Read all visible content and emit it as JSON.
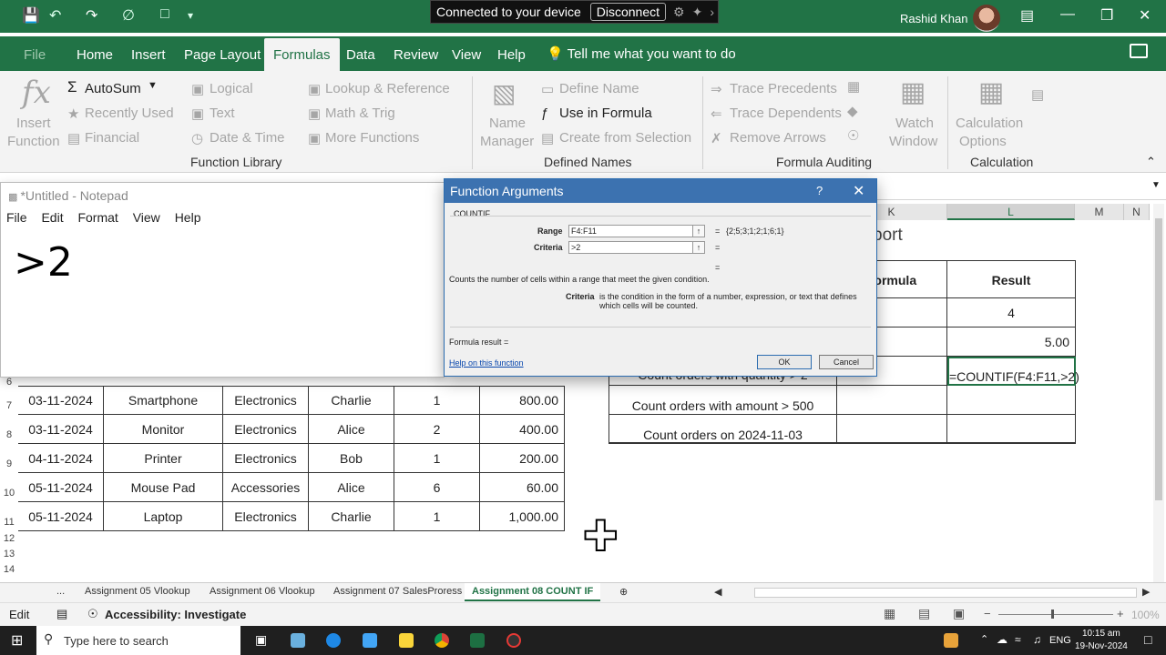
{
  "titlebar": {
    "remote_connected": "Connected to your device",
    "remote_disconnect": "Disconnect",
    "user_name": "Rashid Khan"
  },
  "tabs": [
    "File",
    "Home",
    "Insert",
    "Page Layout",
    "Formulas",
    "Data",
    "Review",
    "View",
    "Help"
  ],
  "active_tab": "Formulas",
  "tell_me": "Tell me what you want to do",
  "ribbon": {
    "insert_function": [
      "Insert",
      "Function"
    ],
    "autosum": "AutoSum",
    "recently_used": "Recently Used",
    "financial": "Financial",
    "logical": "Logical",
    "text": "Text",
    "date_time": "Date & Time",
    "lookup": "Lookup & Reference",
    "math": "Math & Trig",
    "more": "More Functions",
    "group_function_library": "Function Library",
    "name_manager": [
      "Name",
      "Manager"
    ],
    "define_name": "Define Name",
    "use_in_formula": "Use in Formula",
    "create_from_selection": "Create from Selection",
    "group_defined_names": "Defined Names",
    "trace_precedents": "Trace Precedents",
    "trace_dependents": "Trace Dependents",
    "remove_arrows": "Remove Arrows",
    "watch_window": [
      "Watch",
      "Window"
    ],
    "group_formula_auditing": "Formula Auditing",
    "calc_options": [
      "Calculation",
      "Options"
    ],
    "group_calculation": "Calculation"
  },
  "notepad": {
    "title": "*Untitled - Notepad",
    "menu": [
      "File",
      "Edit",
      "Format",
      "View",
      "Help"
    ],
    "content": ">2"
  },
  "dialog": {
    "title": "Function Arguments",
    "help_q": "?",
    "function_name": "COUNTIF",
    "range_label": "Range",
    "range_value": "F4:F11",
    "range_result": "{2;5;3;1;2;1;6;1}",
    "criteria_label": "Criteria",
    "criteria_value": ">2",
    "equals": "=",
    "description": "Counts the number of cells within a range that meet the given condition.",
    "arg_name": "Criteria",
    "arg_desc_1": "is the condition in the form of a number, expression, or text that defines",
    "arg_desc_2": "which cells will be counted.",
    "formula_result": "Formula result =",
    "help_link": "Help on this function",
    "ok": "OK",
    "cancel": "Cancel"
  },
  "sheet": {
    "col_headers": [
      "K",
      "L",
      "M",
      "N"
    ],
    "report_title_fragment": "port",
    "report_headers": [
      "Formula",
      "Result"
    ],
    "report_rows": [
      {
        "label": "",
        "formula": "",
        "result": "4"
      },
      {
        "label": "",
        "formula": "",
        "result": "5.00"
      },
      {
        "label": "Count orders with quantity > 2",
        "formula": "",
        "result": "=COUNTIF(F4:F11,>2)"
      },
      {
        "label": "Count orders with amount > 500",
        "formula": "",
        "result": ""
      },
      {
        "label": "Count orders on 2024-11-03",
        "formula": "",
        "result": ""
      }
    ],
    "data_rows": [
      {
        "row": "7",
        "date": "03-11-2024",
        "product": "Smartphone",
        "category": "Electronics",
        "rep": "Charlie",
        "qty": "1",
        "amount": "800.00"
      },
      {
        "row": "8",
        "date": "03-11-2024",
        "product": "Monitor",
        "category": "Electronics",
        "rep": "Alice",
        "qty": "2",
        "amount": "400.00"
      },
      {
        "row": "9",
        "date": "04-11-2024",
        "product": "Printer",
        "category": "Electronics",
        "rep": "Bob",
        "qty": "1",
        "amount": "200.00"
      },
      {
        "row": "10",
        "date": "05-11-2024",
        "product": "Mouse Pad",
        "category": "Accessories",
        "rep": "Alice",
        "qty": "6",
        "amount": "60.00"
      },
      {
        "row": "11",
        "date": "05-11-2024",
        "product": "Laptop",
        "category": "Electronics",
        "rep": "Charlie",
        "qty": "1",
        "amount": "1,000.00"
      }
    ],
    "row_6": "6",
    "extra_rows": [
      "12",
      "13",
      "14"
    ]
  },
  "sheet_tabs": [
    "...",
    "Assignment 05 Vlookup",
    "Assignment 06 Vlookup",
    "Assignment 07 SalesProress",
    "Assignment 08 COUNT IF"
  ],
  "status": {
    "mode": "Edit",
    "accessibility": "Accessibility: Investigate",
    "zoom": "100%"
  },
  "taskbar": {
    "search": "Type here to search",
    "lang": "ENG",
    "time": "10:15 am",
    "date": "19-Nov-2024"
  }
}
